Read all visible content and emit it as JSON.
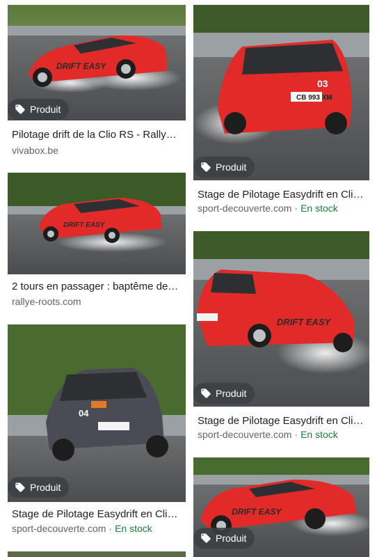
{
  "colors": {
    "badge_bg": "#3c4043",
    "stock_green": "#188038",
    "title_text": "#202124",
    "source_text": "#5f6368",
    "car_red": "#e22b28",
    "car_grey": "#4a4b55"
  },
  "badge_label": "Produit",
  "cards": [
    {
      "title": "Pilotage drift de la Clio RS - Rally…",
      "source": "vivabox.be",
      "stock": "",
      "image": "red-clio-drifting-side"
    },
    {
      "title": "Stage de Pilotage Easydrift en Cli…",
      "source": "sport-decouverte.com",
      "stock": "En stock",
      "image": "red-clio-03-front"
    },
    {
      "title": "2 tours en passager : baptême de…",
      "source": "rallye-roots.com",
      "stock": "",
      "image": "red-clio-drifting-track"
    },
    {
      "title": "Stage de Pilotage Easydrift en Cli…",
      "source": "sport-decouverte.com",
      "stock": "En stock",
      "image": "red-clio-rear-drift"
    },
    {
      "title": "Stage de Pilotage Easydrift en Cli…",
      "source": "sport-decouverte.com",
      "stock": "En stock",
      "image": "grey-clio-04-front"
    },
    {
      "title": "",
      "source": "",
      "stock": "",
      "image": "red-clio-drifting-side-2"
    }
  ],
  "car_numbers": {
    "card2": "03",
    "card5": "04"
  }
}
